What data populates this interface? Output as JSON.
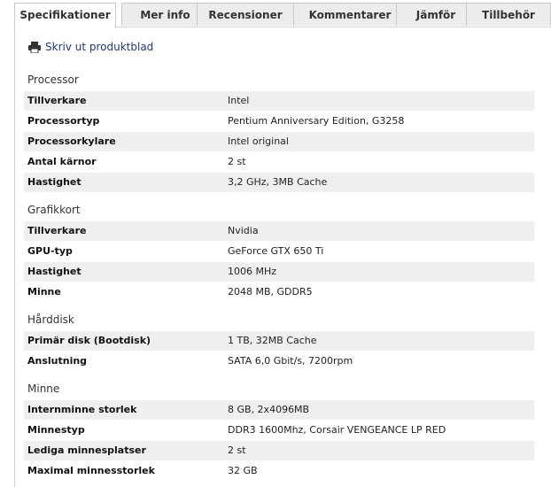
{
  "tabs": [
    {
      "label": "Specifikationer",
      "active": true
    },
    {
      "label": "Mer info"
    },
    {
      "label": "Recensioner"
    },
    {
      "label": "Kommentarer"
    },
    {
      "label": "Jämför"
    },
    {
      "label": "Tillbehör"
    }
  ],
  "print_link": "Skriv ut produktblad",
  "sections": [
    {
      "title": "Processor",
      "rows": [
        {
          "label": "Tillverkare",
          "value": "Intel"
        },
        {
          "label": "Processortyp",
          "value": "Pentium Anniversary Edition, G3258"
        },
        {
          "label": "Processorkylare",
          "value": "Intel original"
        },
        {
          "label": "Antal kärnor",
          "value": "2 st"
        },
        {
          "label": "Hastighet",
          "value": "3,2 GHz, 3MB Cache"
        }
      ]
    },
    {
      "title": "Grafikkort",
      "rows": [
        {
          "label": "Tillverkare",
          "value": "Nvidia"
        },
        {
          "label": "GPU-typ",
          "value": "GeForce GTX 650 Ti"
        },
        {
          "label": "Hastighet",
          "value": "1006 MHz"
        },
        {
          "label": "Minne",
          "value": "2048 MB, GDDR5"
        }
      ]
    },
    {
      "title": "Hårddisk",
      "rows": [
        {
          "label": "Primär disk (Bootdisk)",
          "value": "1 TB, 32MB Cache"
        },
        {
          "label": "Anslutning",
          "value": "SATA 6,0 Gbit/s, 7200rpm"
        }
      ]
    },
    {
      "title": "Minne",
      "rows": [
        {
          "label": "Internminne storlek",
          "value": "8 GB, 2x4096MB"
        },
        {
          "label": "Minnestyp",
          "value": "DDR3 1600Mhz, Corsair VENGEANCE LP RED"
        },
        {
          "label": "Lediga minnesplatser",
          "value": "2 st"
        },
        {
          "label": "Maximal minnesstorlek",
          "value": "32 GB"
        }
      ]
    }
  ]
}
